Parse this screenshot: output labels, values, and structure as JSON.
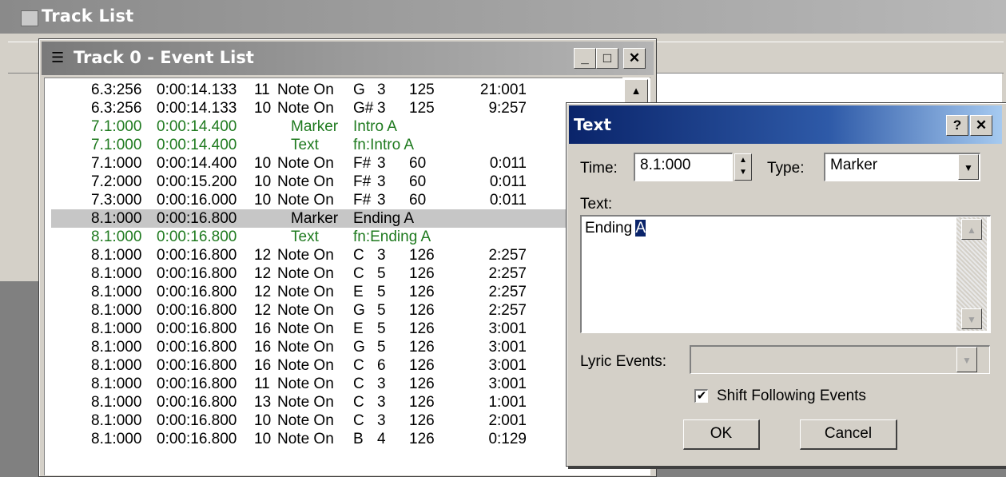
{
  "track_list": {
    "title": "Track List"
  },
  "event_window": {
    "title": "Track 0 - Event List",
    "min_label": "_",
    "max_label": "□",
    "close_label": "✕",
    "rows": [
      {
        "pos": "6.3:256",
        "time": "0:00:14.133",
        "ch": "11",
        "kind": "Note On",
        "n1": "G",
        "n2": "3",
        "vel": "125",
        "dur": "21:001",
        "style": "normal"
      },
      {
        "pos": "6.3:256",
        "time": "0:00:14.133",
        "ch": "10",
        "kind": "Note On",
        "n1": "G#",
        "n2": "3",
        "vel": "125",
        "dur": "9:257",
        "style": "normal"
      },
      {
        "pos": "7.1:000",
        "time": "0:00:14.400",
        "ch": "",
        "kind": "Marker",
        "value": "Intro A",
        "style": "green"
      },
      {
        "pos": "7.1:000",
        "time": "0:00:14.400",
        "ch": "",
        "kind": "Text",
        "value": "fn:Intro A",
        "style": "green"
      },
      {
        "pos": "7.1:000",
        "time": "0:00:14.400",
        "ch": "10",
        "kind": "Note On",
        "n1": "F#",
        "n2": "3",
        "vel": "60",
        "dur": "0:011",
        "style": "normal"
      },
      {
        "pos": "7.2:000",
        "time": "0:00:15.200",
        "ch": "10",
        "kind": "Note On",
        "n1": "F#",
        "n2": "3",
        "vel": "60",
        "dur": "0:011",
        "style": "normal"
      },
      {
        "pos": "7.3:000",
        "time": "0:00:16.000",
        "ch": "10",
        "kind": "Note On",
        "n1": "F#",
        "n2": "3",
        "vel": "60",
        "dur": "0:011",
        "style": "normal"
      },
      {
        "pos": "8.1:000",
        "time": "0:00:16.800",
        "ch": "",
        "kind": "Marker",
        "value": "Ending A",
        "style": "sel"
      },
      {
        "pos": "8.1:000",
        "time": "0:00:16.800",
        "ch": "",
        "kind": "Text",
        "value": "fn:Ending A",
        "style": "green"
      },
      {
        "pos": "8.1:000",
        "time": "0:00:16.800",
        "ch": "12",
        "kind": "Note On",
        "n1": "C",
        "n2": "3",
        "vel": "126",
        "dur": "2:257",
        "style": "normal"
      },
      {
        "pos": "8.1:000",
        "time": "0:00:16.800",
        "ch": "12",
        "kind": "Note On",
        "n1": "C",
        "n2": "5",
        "vel": "126",
        "dur": "2:257",
        "style": "normal"
      },
      {
        "pos": "8.1:000",
        "time": "0:00:16.800",
        "ch": "12",
        "kind": "Note On",
        "n1": "E",
        "n2": "5",
        "vel": "126",
        "dur": "2:257",
        "style": "normal"
      },
      {
        "pos": "8.1:000",
        "time": "0:00:16.800",
        "ch": "12",
        "kind": "Note On",
        "n1": "G",
        "n2": "5",
        "vel": "126",
        "dur": "2:257",
        "style": "normal"
      },
      {
        "pos": "8.1:000",
        "time": "0:00:16.800",
        "ch": "16",
        "kind": "Note On",
        "n1": "E",
        "n2": "5",
        "vel": "126",
        "dur": "3:001",
        "style": "normal"
      },
      {
        "pos": "8.1:000",
        "time": "0:00:16.800",
        "ch": "16",
        "kind": "Note On",
        "n1": "G",
        "n2": "5",
        "vel": "126",
        "dur": "3:001",
        "style": "normal"
      },
      {
        "pos": "8.1:000",
        "time": "0:00:16.800",
        "ch": "16",
        "kind": "Note On",
        "n1": "C",
        "n2": "6",
        "vel": "126",
        "dur": "3:001",
        "style": "normal"
      },
      {
        "pos": "8.1:000",
        "time": "0:00:16.800",
        "ch": "11",
        "kind": "Note On",
        "n1": "C",
        "n2": "3",
        "vel": "126",
        "dur": "3:001",
        "style": "normal"
      },
      {
        "pos": "8.1:000",
        "time": "0:00:16.800",
        "ch": "13",
        "kind": "Note On",
        "n1": "C",
        "n2": "3",
        "vel": "126",
        "dur": "1:001",
        "style": "normal"
      },
      {
        "pos": "8.1:000",
        "time": "0:00:16.800",
        "ch": "10",
        "kind": "Note On",
        "n1": "C",
        "n2": "3",
        "vel": "126",
        "dur": "2:001",
        "style": "normal"
      },
      {
        "pos": "8.1:000",
        "time": "0:00:16.800",
        "ch": "10",
        "kind": "Note On",
        "n1": "B",
        "n2": "4",
        "vel": "126",
        "dur": "0:129",
        "style": "normal"
      }
    ]
  },
  "dialog": {
    "title": "Text",
    "help_label": "?",
    "close_label": "✕",
    "time_label": "Time:",
    "time_value": "8.1:000",
    "type_label": "Type:",
    "type_value": "Marker",
    "text_label": "Text:",
    "text_value_plain": "Ending ",
    "text_value_selected": "A",
    "lyric_label": "Lyric Events:",
    "lyric_value": "",
    "shift_label": "Shift Following Events",
    "shift_checked": true,
    "ok_label": "OK",
    "cancel_label": "Cancel"
  },
  "colors": {
    "green_text": "#1f7a1f",
    "dialog_title": "#0a246a"
  }
}
